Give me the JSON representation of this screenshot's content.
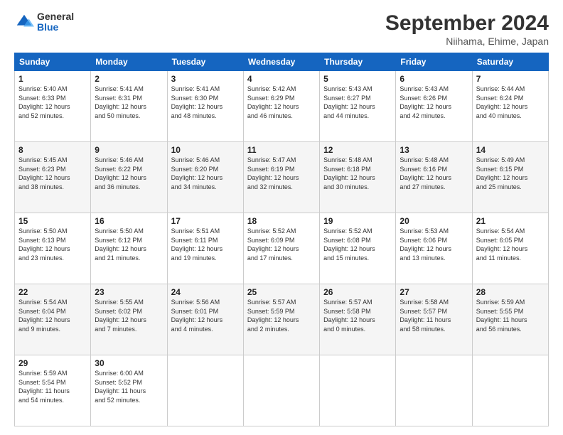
{
  "logo": {
    "general": "General",
    "blue": "Blue"
  },
  "header": {
    "title": "September 2024",
    "location": "Niihama, Ehime, Japan"
  },
  "weekdays": [
    "Sunday",
    "Monday",
    "Tuesday",
    "Wednesday",
    "Thursday",
    "Friday",
    "Saturday"
  ],
  "weeks": [
    [
      {
        "day": "1",
        "info": "Sunrise: 5:40 AM\nSunset: 6:33 PM\nDaylight: 12 hours\nand 52 minutes."
      },
      {
        "day": "2",
        "info": "Sunrise: 5:41 AM\nSunset: 6:31 PM\nDaylight: 12 hours\nand 50 minutes."
      },
      {
        "day": "3",
        "info": "Sunrise: 5:41 AM\nSunset: 6:30 PM\nDaylight: 12 hours\nand 48 minutes."
      },
      {
        "day": "4",
        "info": "Sunrise: 5:42 AM\nSunset: 6:29 PM\nDaylight: 12 hours\nand 46 minutes."
      },
      {
        "day": "5",
        "info": "Sunrise: 5:43 AM\nSunset: 6:27 PM\nDaylight: 12 hours\nand 44 minutes."
      },
      {
        "day": "6",
        "info": "Sunrise: 5:43 AM\nSunset: 6:26 PM\nDaylight: 12 hours\nand 42 minutes."
      },
      {
        "day": "7",
        "info": "Sunrise: 5:44 AM\nSunset: 6:24 PM\nDaylight: 12 hours\nand 40 minutes."
      }
    ],
    [
      {
        "day": "8",
        "info": "Sunrise: 5:45 AM\nSunset: 6:23 PM\nDaylight: 12 hours\nand 38 minutes."
      },
      {
        "day": "9",
        "info": "Sunrise: 5:46 AM\nSunset: 6:22 PM\nDaylight: 12 hours\nand 36 minutes."
      },
      {
        "day": "10",
        "info": "Sunrise: 5:46 AM\nSunset: 6:20 PM\nDaylight: 12 hours\nand 34 minutes."
      },
      {
        "day": "11",
        "info": "Sunrise: 5:47 AM\nSunset: 6:19 PM\nDaylight: 12 hours\nand 32 minutes."
      },
      {
        "day": "12",
        "info": "Sunrise: 5:48 AM\nSunset: 6:18 PM\nDaylight: 12 hours\nand 30 minutes."
      },
      {
        "day": "13",
        "info": "Sunrise: 5:48 AM\nSunset: 6:16 PM\nDaylight: 12 hours\nand 27 minutes."
      },
      {
        "day": "14",
        "info": "Sunrise: 5:49 AM\nSunset: 6:15 PM\nDaylight: 12 hours\nand 25 minutes."
      }
    ],
    [
      {
        "day": "15",
        "info": "Sunrise: 5:50 AM\nSunset: 6:13 PM\nDaylight: 12 hours\nand 23 minutes."
      },
      {
        "day": "16",
        "info": "Sunrise: 5:50 AM\nSunset: 6:12 PM\nDaylight: 12 hours\nand 21 minutes."
      },
      {
        "day": "17",
        "info": "Sunrise: 5:51 AM\nSunset: 6:11 PM\nDaylight: 12 hours\nand 19 minutes."
      },
      {
        "day": "18",
        "info": "Sunrise: 5:52 AM\nSunset: 6:09 PM\nDaylight: 12 hours\nand 17 minutes."
      },
      {
        "day": "19",
        "info": "Sunrise: 5:52 AM\nSunset: 6:08 PM\nDaylight: 12 hours\nand 15 minutes."
      },
      {
        "day": "20",
        "info": "Sunrise: 5:53 AM\nSunset: 6:06 PM\nDaylight: 12 hours\nand 13 minutes."
      },
      {
        "day": "21",
        "info": "Sunrise: 5:54 AM\nSunset: 6:05 PM\nDaylight: 12 hours\nand 11 minutes."
      }
    ],
    [
      {
        "day": "22",
        "info": "Sunrise: 5:54 AM\nSunset: 6:04 PM\nDaylight: 12 hours\nand 9 minutes."
      },
      {
        "day": "23",
        "info": "Sunrise: 5:55 AM\nSunset: 6:02 PM\nDaylight: 12 hours\nand 7 minutes."
      },
      {
        "day": "24",
        "info": "Sunrise: 5:56 AM\nSunset: 6:01 PM\nDaylight: 12 hours\nand 4 minutes."
      },
      {
        "day": "25",
        "info": "Sunrise: 5:57 AM\nSunset: 5:59 PM\nDaylight: 12 hours\nand 2 minutes."
      },
      {
        "day": "26",
        "info": "Sunrise: 5:57 AM\nSunset: 5:58 PM\nDaylight: 12 hours\nand 0 minutes."
      },
      {
        "day": "27",
        "info": "Sunrise: 5:58 AM\nSunset: 5:57 PM\nDaylight: 11 hours\nand 58 minutes."
      },
      {
        "day": "28",
        "info": "Sunrise: 5:59 AM\nSunset: 5:55 PM\nDaylight: 11 hours\nand 56 minutes."
      }
    ],
    [
      {
        "day": "29",
        "info": "Sunrise: 5:59 AM\nSunset: 5:54 PM\nDaylight: 11 hours\nand 54 minutes."
      },
      {
        "day": "30",
        "info": "Sunrise: 6:00 AM\nSunset: 5:52 PM\nDaylight: 11 hours\nand 52 minutes."
      },
      {
        "day": "",
        "info": ""
      },
      {
        "day": "",
        "info": ""
      },
      {
        "day": "",
        "info": ""
      },
      {
        "day": "",
        "info": ""
      },
      {
        "day": "",
        "info": ""
      }
    ]
  ]
}
